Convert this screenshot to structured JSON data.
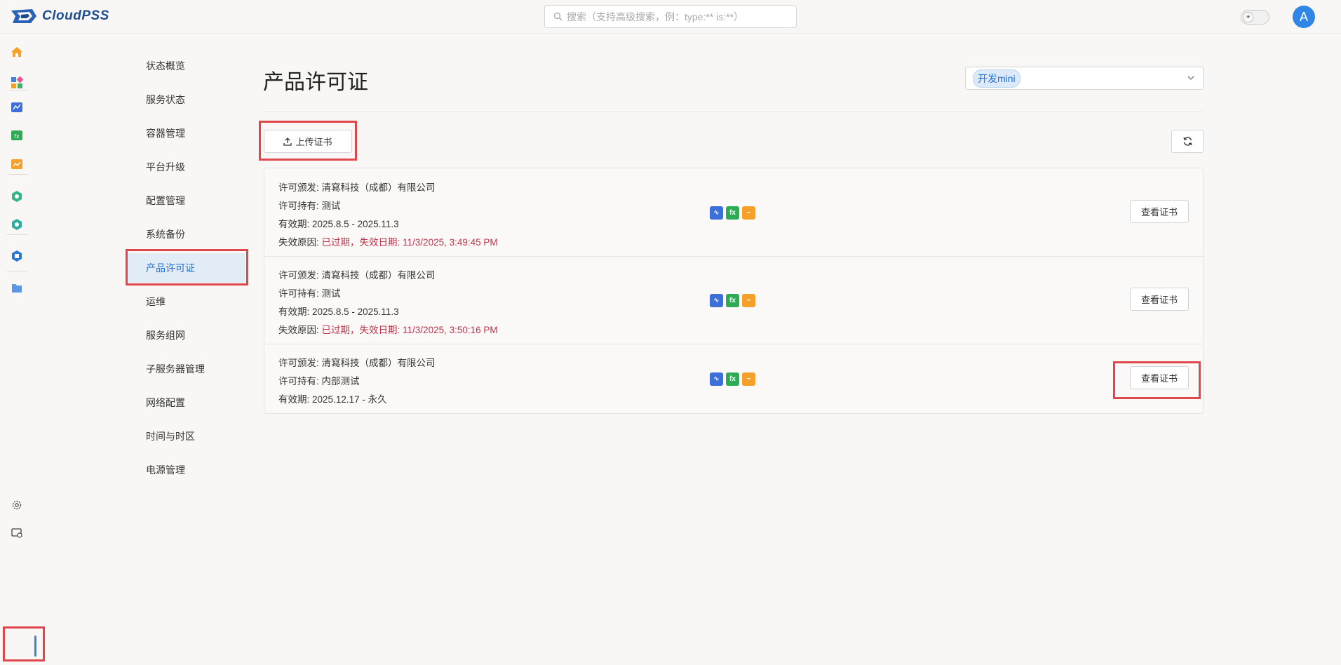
{
  "app": {
    "logo_text": "CloudPSS"
  },
  "search": {
    "placeholder": "搜索（支持高级搜索，例：type:** is:**）"
  },
  "user": {
    "avatar_letter": "A"
  },
  "nav": {
    "items": [
      {
        "label": "状态概览"
      },
      {
        "label": "服务状态"
      },
      {
        "label": "容器管理"
      },
      {
        "label": "平台升级"
      },
      {
        "label": "配置管理"
      },
      {
        "label": "系统备份"
      },
      {
        "label": "产品许可证"
      },
      {
        "label": "运维"
      },
      {
        "label": "服务组网"
      },
      {
        "label": "子服务器管理"
      },
      {
        "label": "网络配置"
      },
      {
        "label": "时间与时区"
      },
      {
        "label": "电源管理"
      }
    ],
    "active_index": 6
  },
  "page": {
    "title": "产品许可证",
    "product_select": {
      "selected": "开发mini"
    },
    "upload_label": "上传证书"
  },
  "licenses": [
    {
      "issuer_label": "许可颁发:",
      "issuer": "清寫科技（成都）有限公司",
      "holder_label": "许可持有:",
      "holder": "测试",
      "validity_label": "有效期:",
      "validity": "2025.8.5 - 2025.11.3",
      "failure_label": "失效原因:",
      "failure": "已过期，失效日期: 11/3/2025, 3:49:45 PM",
      "view_label": "查看证书"
    },
    {
      "issuer_label": "许可颁发:",
      "issuer": "清寫科技（成都）有限公司",
      "holder_label": "许可持有:",
      "holder": "测试",
      "validity_label": "有效期:",
      "validity": "2025.8.5 - 2025.11.3",
      "failure_label": "失效原因:",
      "failure": "已过期，失效日期: 11/3/2025, 3:50:16 PM",
      "view_label": "查看证书"
    },
    {
      "issuer_label": "许可颁发:",
      "issuer": "清寫科技（成都）有限公司",
      "holder_label": "许可持有:",
      "holder": "内部测试",
      "validity_label": "有效期:",
      "validity": "2025.12.17 - 永久",
      "view_label": "查看证书"
    }
  ],
  "colors": {
    "accent": "#1f6fd1",
    "error": "#c2334a",
    "highlight": "#e0474c"
  }
}
